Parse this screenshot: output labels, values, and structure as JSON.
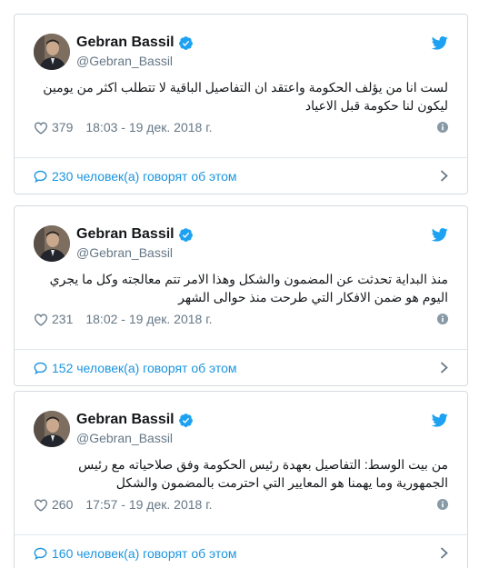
{
  "colors": {
    "link": "#1b95e0",
    "muted": "#657786",
    "border": "#d5dbe0",
    "verified": "#1da1f2"
  },
  "tweets": [
    {
      "display_name": "Gebran Bassil",
      "handle": "@Gebran_Bassil",
      "text": "لست انا من يؤلف الحكومة واعتقد ان التفاصيل الباقية لا تتطلب اكثر من يومين ليكون لنا حكومة قبل الاعياد",
      "likes": "379",
      "timestamp": "18:03 - 19 дек. 2018 г.",
      "footer": "230 человек(а) говорят об этом"
    },
    {
      "display_name": "Gebran Bassil",
      "handle": "@Gebran_Bassil",
      "text": "منذ البداية تحدثت عن المضمون والشكل وهذا الامر تتم معالجته وكل ما يجري اليوم هو ضمن الافكار التي طرحت منذ حوالى الشهر",
      "likes": "231",
      "timestamp": "18:02 - 19 дек. 2018 г.",
      "footer": "152 человек(а) говорят об этом"
    },
    {
      "display_name": "Gebran Bassil",
      "handle": "@Gebran_Bassil",
      "text": "من بيت الوسط: التفاصيل بعهدة رئيس الحكومة وفق صلاحياته مع رئيس الجمهورية وما يهمنا هو المعايير التي احترمت بالمضمون والشكل",
      "likes": "260",
      "timestamp": "17:57 - 19 дек. 2018 г.",
      "footer": "160 человек(а) говорят об этом"
    }
  ]
}
